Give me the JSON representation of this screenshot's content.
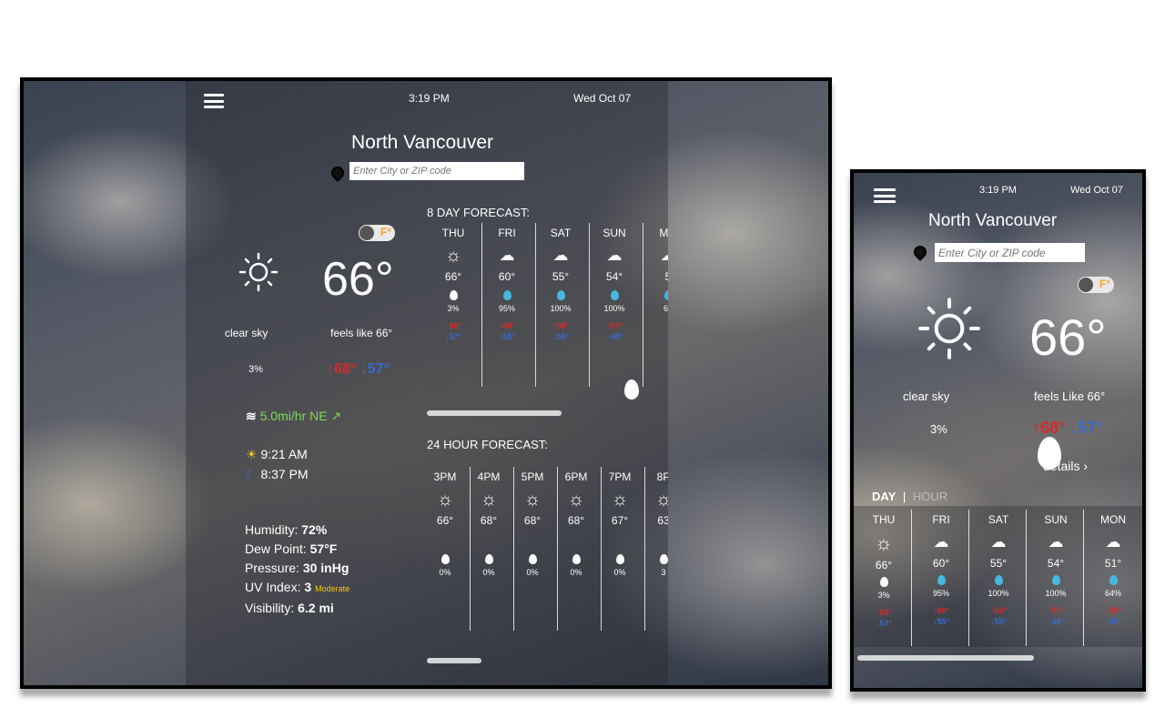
{
  "colors": {
    "hi": "#d12c2c",
    "lo": "#3a6ac8",
    "wind": "#7ed957",
    "uv_label": "#f5c518",
    "rain_drop": "#46b8e0"
  },
  "tablet": {
    "time": "3:19 PM",
    "date": "Wed Oct 07",
    "city": "North Vancouver",
    "search_placeholder": "Enter City or ZIP code",
    "unit_toggle": "F°",
    "current": {
      "icon": "sun-icon",
      "temp": "66°",
      "condition": "clear sky",
      "feels_like": "feels like 66°",
      "precip": "3%",
      "hi": "↑68°",
      "lo": "↓57°",
      "wind": "5.0mi/hr NE ↗",
      "sunrise": "9:21 AM",
      "sunset": "8:37 PM",
      "stats": [
        {
          "label": "Humidity:",
          "value": "72%"
        },
        {
          "label": "Dew Point:",
          "value": "57°F"
        },
        {
          "label": "Pressure:",
          "value": "30 inHg"
        },
        {
          "label": "UV Index:",
          "value": "3",
          "extra": "Moderate"
        },
        {
          "label": "Visibility:",
          "value": "6.2 mi"
        }
      ]
    },
    "day_forecast_title": "8 DAY FORECAST:",
    "days": [
      {
        "name": "THU",
        "icon": "sun-icon",
        "temp": "66°",
        "precip": "3%",
        "hi": "↑68°",
        "lo": "↓57°"
      },
      {
        "name": "FRI",
        "icon": "rain-cloud-icon",
        "temp": "60°",
        "precip": "95%",
        "hi": "↑60°",
        "lo": "↓55°"
      },
      {
        "name": "SAT",
        "icon": "rain-cloud-icon",
        "temp": "55°",
        "precip": "100%",
        "hi": "↑56°",
        "lo": "↓55°"
      },
      {
        "name": "SUN",
        "icon": "rain-cloud-icon",
        "temp": "54°",
        "precip": "100%",
        "hi": "↑57°",
        "lo": "↓48°"
      },
      {
        "name": "MO",
        "icon": "rain-cloud-icon",
        "temp": "5",
        "precip": "64",
        "hi": "↑5",
        "lo": "↓4"
      }
    ],
    "hour_forecast_title": "24 HOUR FORECAST:",
    "hours": [
      {
        "name": "3PM",
        "temp": "66°",
        "precip": "0%"
      },
      {
        "name": "4PM",
        "temp": "68°",
        "precip": "0%"
      },
      {
        "name": "5PM",
        "temp": "68°",
        "precip": "0%"
      },
      {
        "name": "6PM",
        "temp": "68°",
        "precip": "0%"
      },
      {
        "name": "7PM",
        "temp": "67°",
        "precip": "0%"
      },
      {
        "name": "8P",
        "temp": "63",
        "precip": "3"
      }
    ]
  },
  "phone": {
    "time": "3:19 PM",
    "date": "Wed Oct 07",
    "city": "North Vancouver",
    "search_placeholder": "Enter City or ZIP code",
    "unit_toggle": "F°",
    "temp": "66°",
    "condition": "clear sky",
    "feels_like": "feels Like 66°",
    "precip": "3%",
    "hi": "↑68°",
    "lo": "↓57°",
    "details": "details",
    "tab_day": "DAY",
    "tab_hour": "HOUR",
    "days": [
      {
        "name": "THU",
        "icon": "sun-icon",
        "temp": "66°",
        "precip": "3%",
        "hi": "↑68°",
        "lo": "↓57°"
      },
      {
        "name": "FRI",
        "icon": "rain-cloud-icon",
        "temp": "60°",
        "precip": "95%",
        "hi": "↑60°",
        "lo": "↓55°"
      },
      {
        "name": "SAT",
        "icon": "rain-cloud-icon",
        "temp": "55°",
        "precip": "100%",
        "hi": "↑56°",
        "lo": "↓55°"
      },
      {
        "name": "SUN",
        "icon": "rain-cloud-icon",
        "temp": "54°",
        "precip": "100%",
        "hi": "↑57°",
        "lo": "↓48°"
      },
      {
        "name": "MON",
        "icon": "rain-cloud-icon",
        "temp": "51°",
        "precip": "64%",
        "hi": "↑55°",
        "lo": "↓46°"
      }
    ]
  }
}
